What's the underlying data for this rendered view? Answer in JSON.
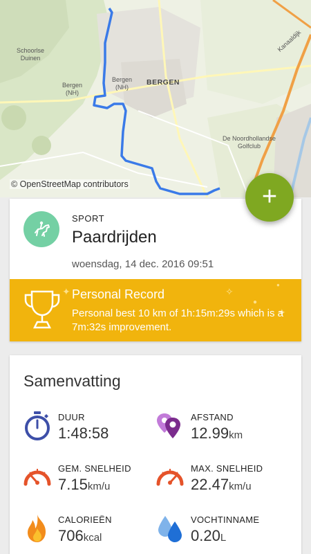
{
  "map": {
    "credit": "© OpenStreetMap contributors",
    "labels": {
      "schoorl": "Schoorlse\nDuinen",
      "bergen_nh_left": "Bergen\n(NH)",
      "bergen_nh_mid": "Bergen\n(NH)",
      "bergen": "BERGEN",
      "golfclub": "De Noordhollandse\nGolfclub",
      "kanaaldijk": "Kanaaldijk"
    }
  },
  "fab": {
    "label": "+"
  },
  "activity": {
    "sport_label": "SPORT",
    "sport_name": "Paardrijden",
    "date": "woensdag, 14 dec. 2016 09:51",
    "sport_icon": "horse-riding-icon"
  },
  "record": {
    "title": "Personal Record",
    "text": "Personal best 10 km of 1h:15m:29s which is a 7m:32s improvement.",
    "icon": "trophy-icon"
  },
  "summary": {
    "title": "Samenvatting",
    "stats": [
      {
        "label": "DUUR",
        "value": "1:48:58",
        "unit": "",
        "icon": "stopwatch-icon"
      },
      {
        "label": "AFSTAND",
        "value": "12.99",
        "unit": "km",
        "icon": "location-pin-icon"
      },
      {
        "label": "GEM. SNELHEID",
        "value": "7.15",
        "unit": "km/u",
        "icon": "speedometer-icon"
      },
      {
        "label": "MAX. SNELHEID",
        "value": "22.47",
        "unit": "km/u",
        "icon": "speedometer-icon"
      },
      {
        "label": "CALORIEËN",
        "value": "706",
        "unit": "kcal",
        "icon": "flame-icon"
      },
      {
        "label": "VOCHTINNAME",
        "value": "0.20",
        "unit": "L",
        "icon": "water-drops-icon"
      }
    ]
  },
  "colors": {
    "fab": "#7fa821",
    "record_bg": "#f1b40d",
    "sport_icon_bg": "#74d0a4",
    "route": "#3a7ae8"
  }
}
